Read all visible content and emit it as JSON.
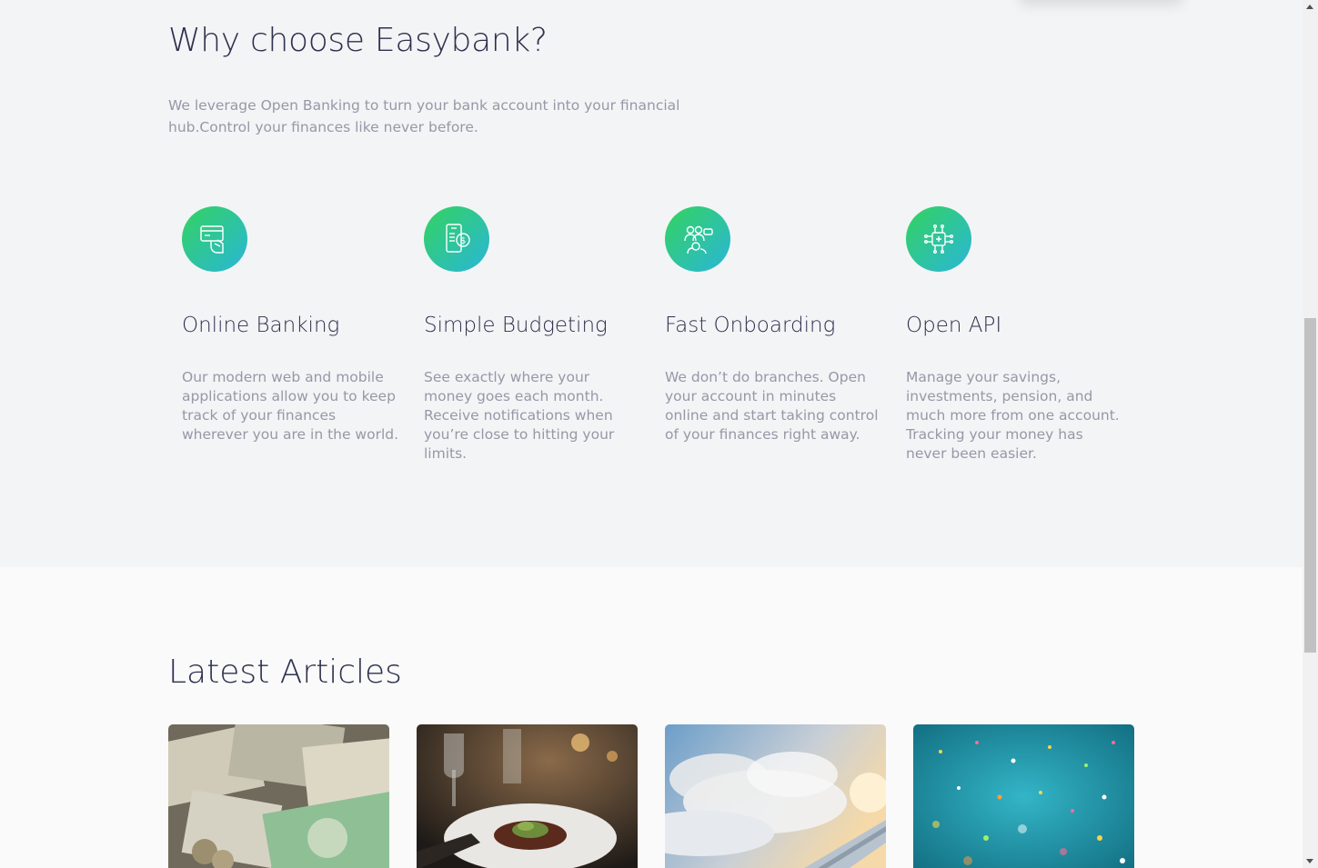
{
  "why": {
    "title": "Why choose Easybank?",
    "subtitle": "We leverage Open Banking to turn your bank account into your financial hub.Control your finances like never before.",
    "features": [
      {
        "icon": "online-banking-icon",
        "title": "Online Banking",
        "text": "Our modern web and mobile applications allow you to keep track of your finances wherever you are in the world."
      },
      {
        "icon": "budgeting-icon",
        "title": "Simple Budgeting",
        "text": "See exactly where your money goes each month. Receive notifications when you’re close to hitting your limits."
      },
      {
        "icon": "onboarding-icon",
        "title": "Fast Onboarding",
        "text": "We don’t do branches. Open your account in minutes online and start taking control of your finances right away."
      },
      {
        "icon": "api-icon",
        "title": "Open API",
        "text": "Manage your savings, investments, pension, and much more from one account. Tracking your money has never been easier."
      }
    ]
  },
  "articles": {
    "title": "Latest Articles",
    "cards": [
      {
        "image": "currency-photo"
      },
      {
        "image": "restaurant-photo"
      },
      {
        "image": "plane-photo"
      },
      {
        "image": "confetti-photo"
      }
    ]
  },
  "colors": {
    "heading": "#2d314d",
    "body_text": "#9698a6",
    "gradient_start": "#33d35e",
    "gradient_end": "#2ab6d9",
    "section_bg": "#f3f4f6"
  }
}
